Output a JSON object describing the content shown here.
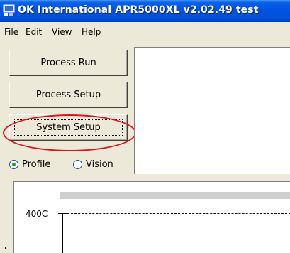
{
  "window": {
    "title": "OK International APR5000XL  v2.02.49 test",
    "icon": "app-icon"
  },
  "menu": {
    "items": [
      "File",
      "Edit",
      "View",
      "Help"
    ]
  },
  "left_panel": {
    "buttons": [
      {
        "label": "Process Run"
      },
      {
        "label": "Process Setup"
      },
      {
        "label": "System Setup",
        "focused": true,
        "highlighted": true
      }
    ],
    "radios": [
      {
        "label": "Profile",
        "checked": true
      },
      {
        "label": "Vision",
        "checked": false
      }
    ]
  },
  "graph": {
    "y_label": "400C"
  },
  "colors": {
    "titlebar": "#0054e3",
    "highlight": "#e0141b",
    "radio_dot": "#21a121",
    "face": "#ece9d8"
  }
}
